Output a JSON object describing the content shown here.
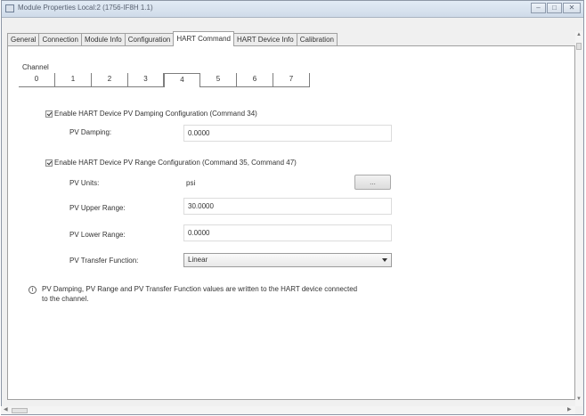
{
  "window": {
    "title": "Module Properties Local:2 (1756-IF8H 1.1)",
    "controls": [
      "‒",
      "□",
      "✕"
    ]
  },
  "tabs": [
    {
      "label": "General"
    },
    {
      "label": "Connection"
    },
    {
      "label": "Module Info"
    },
    {
      "label": "Configuration"
    },
    {
      "label": "HART Command",
      "active": true
    },
    {
      "label": "HART Device Info"
    },
    {
      "label": "Calibration"
    }
  ],
  "channel": {
    "label": "Channel",
    "tabs": [
      "0",
      "1",
      "2",
      "3",
      "4",
      "5",
      "6",
      "7"
    ],
    "selected": "4"
  },
  "damping": {
    "enable_label": "Enable HART Device PV Damping Configuration (Command 34)",
    "checked": true,
    "pv_damping_label": "PV Damping:",
    "pv_damping_value": "0.0000"
  },
  "range": {
    "enable_label": "Enable HART Device PV Range Configuration (Command 35, Command 47)",
    "checked": true,
    "pv_units_label": "PV Units:",
    "pv_units_value": "psi",
    "units_button_label": "...",
    "pv_upper_label": "PV Upper Range:",
    "pv_upper_value": "30.0000",
    "pv_lower_label": "PV Lower Range:",
    "pv_lower_value": "0.0000",
    "transfer_label": "PV Transfer Function:",
    "transfer_value": "Linear"
  },
  "info": {
    "icon": "info-icon",
    "text_line1": "PV Damping, PV Range and PV Transfer Function values are written to the HART device connected",
    "text_line2": "to the channel."
  },
  "scroll": {
    "up": "▲",
    "down": "▼",
    "left": "◀",
    "right": "▶"
  }
}
